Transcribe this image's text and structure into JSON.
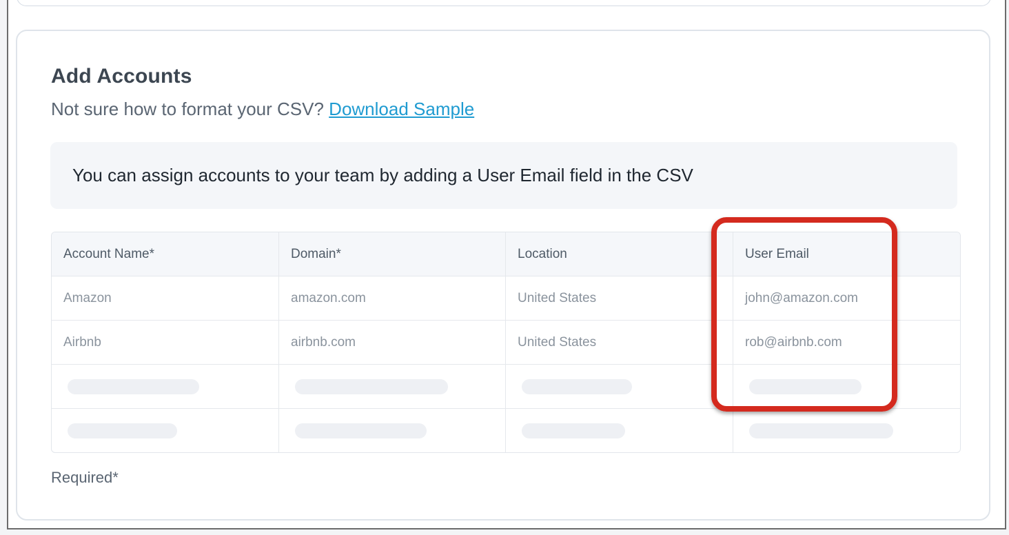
{
  "section": {
    "title": "Add Accounts",
    "subtitle_prefix": "Not sure how to format your CSV? ",
    "download_link": "Download Sample",
    "info": "You can assign accounts to your team by adding a User Email field in the CSV",
    "required_note": "Required*"
  },
  "table": {
    "headers": [
      "Account Name*",
      "Domain*",
      "Location",
      "User Email"
    ],
    "rows": [
      [
        "Amazon",
        "amazon.com",
        "United States",
        "john@amazon.com"
      ],
      [
        "Airbnb",
        "airbnb.com",
        "United States",
        "rob@airbnb.com"
      ]
    ]
  },
  "colors": {
    "link": "#1f9bd1",
    "highlight": "#d42a1e"
  }
}
